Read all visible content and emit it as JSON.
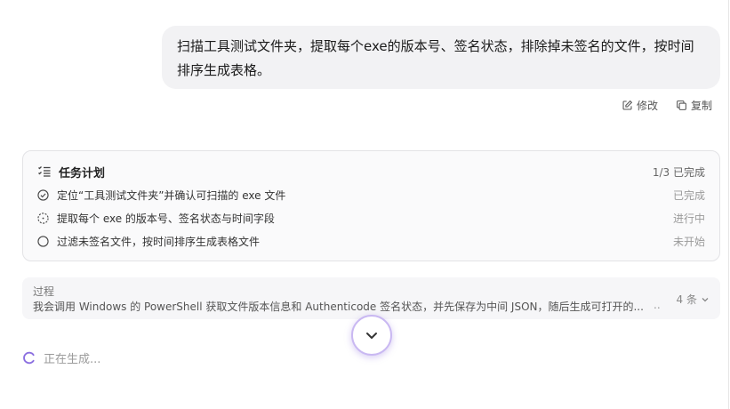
{
  "user_message": {
    "text": "扫描工具测试文件夹，提取每个exe的版本号、签名状态，排除掉未签名的文件，按时间排序生成表格。"
  },
  "message_actions": {
    "edit_label": "修改",
    "copy_label": "复制"
  },
  "task_plan": {
    "title": "任务计划",
    "progress": "1/3 已完成",
    "items": [
      {
        "text": "定位“工具测试文件夹”并确认可扫描的 exe 文件",
        "status": "已完成",
        "state": "done"
      },
      {
        "text": "提取每个 exe 的版本号、签名状态与时间字段",
        "status": "进行中",
        "state": "in-progress"
      },
      {
        "text": "过滤未签名文件，按时间排序生成表格文件",
        "status": "未开始",
        "state": "todo"
      }
    ]
  },
  "process": {
    "label": "过程",
    "text": "我会调用 Windows 的 PowerShell 获取文件版本信息和 Authenticode 签名状态，并先保存为中间 JSON，随后生成可打开的...",
    "trailing": "..",
    "count": "4 条"
  },
  "status": {
    "generating": "正在生成..."
  },
  "colors": {
    "accent": "#8b6fe0",
    "bubble": "#f2f2f4",
    "muted": "#9a9a9a"
  }
}
